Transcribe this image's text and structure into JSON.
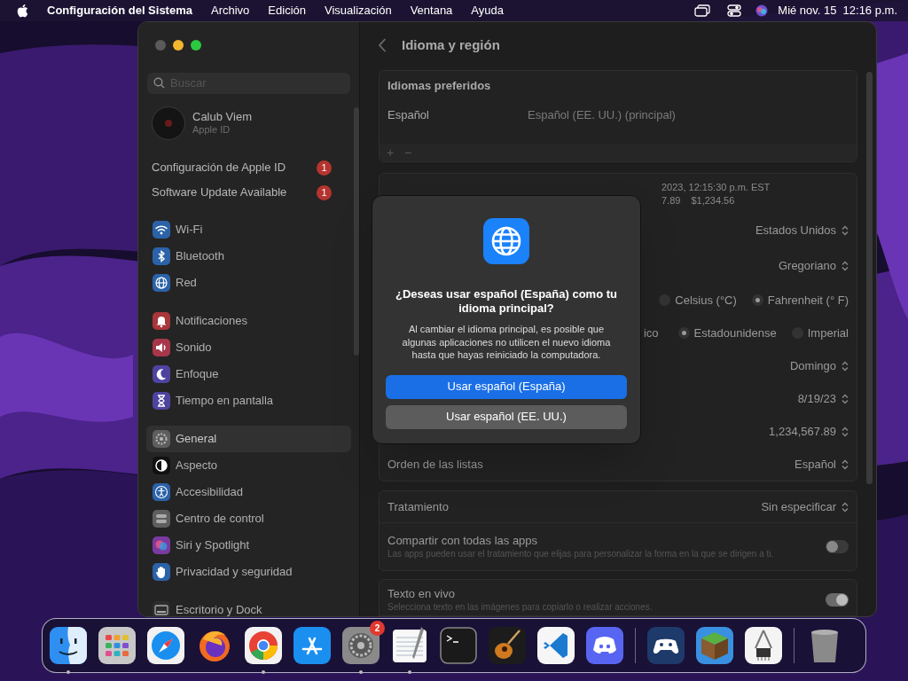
{
  "menu_bar": {
    "app_name": "Configuración del Sistema",
    "menus": [
      "Archivo",
      "Edición",
      "Visualización",
      "Ventana",
      "Ayuda"
    ],
    "date": "Mié nov. 15",
    "time": "12:16 p.m."
  },
  "sidebar": {
    "search": {
      "placeholder": "Buscar"
    },
    "account": {
      "name": "Calub Viem",
      "subtitle": "Apple ID"
    },
    "alerts": [
      {
        "label": "Configuración de Apple ID",
        "badge": "1"
      },
      {
        "label": "Software Update Available",
        "badge": "1"
      }
    ],
    "groups": [
      [
        {
          "label": "Wi-Fi",
          "kind": "wifi",
          "color": "#2b62a8",
          "selected": false
        },
        {
          "label": "Bluetooth",
          "kind": "bluetooth",
          "color": "#2b62a8",
          "selected": false
        },
        {
          "label": "Red",
          "kind": "globe",
          "color": "#2b62a8",
          "selected": false
        }
      ],
      [
        {
          "label": "Notificaciones",
          "kind": "bell",
          "color": "#a8363a",
          "selected": false
        },
        {
          "label": "Sonido",
          "kind": "speaker",
          "color": "#a8364a",
          "selected": false
        },
        {
          "label": "Enfoque",
          "kind": "moon",
          "color": "#4e44a0",
          "selected": false
        },
        {
          "label": "Tiempo en pantalla",
          "kind": "hourglass",
          "color": "#4e44a0",
          "selected": false
        }
      ],
      [
        {
          "label": "General",
          "kind": "gear",
          "color": "#5e5e5e",
          "selected": true
        },
        {
          "label": "Aspecto",
          "kind": "contrast",
          "color": "#111111",
          "selected": false
        },
        {
          "label": "Accesibilidad",
          "kind": "person",
          "color": "#2b62a8",
          "selected": false
        },
        {
          "label": "Centro de control",
          "kind": "switches",
          "color": "#5e5e5e",
          "selected": false
        },
        {
          "label": "Siri y Spotlight",
          "kind": "orb",
          "color": "#7a3aa0",
          "selected": false
        },
        {
          "label": "Privacidad y seguridad",
          "kind": "hand",
          "color": "#2b62a8",
          "selected": false
        }
      ],
      [
        {
          "label": "Escritorio y Dock",
          "kind": "dock",
          "color": "#2e2e2e",
          "selected": false
        }
      ]
    ]
  },
  "content": {
    "title": "Idioma y región",
    "preferred_languages": {
      "heading": "Idiomas preferidos",
      "languages": [
        {
          "name": "Español",
          "detail": "Español (EE. UU.) (principal)"
        }
      ],
      "buttons": [
        "+",
        "−"
      ]
    },
    "format_preview": {
      "line_1": "2023, 12:15:30 p.m. EST",
      "line_2": [
        "7.89",
        "$1,234.56"
      ]
    },
    "format_rows": [
      {
        "kind": "popup",
        "value": "Estados Unidos"
      },
      {
        "kind": "popup",
        "value": "Gregoriano"
      },
      {
        "kind": "radio",
        "options": [
          {
            "label": "Celsius (°C)",
            "selected": false
          },
          {
            "label": "Fahrenheit (° F)",
            "selected": true
          }
        ]
      },
      {
        "kind": "radio",
        "partial_label": "ico",
        "options": [
          {
            "label": "Estadounidense",
            "selected": true
          },
          {
            "label": "Imperial",
            "selected": false
          }
        ]
      },
      {
        "kind": "popup",
        "value": "Domingo"
      },
      {
        "kind": "popup",
        "value": "8/19/23"
      },
      {
        "kind": "popup",
        "value": "1,234,567.89"
      },
      {
        "kind": "popup",
        "label": "Orden de las listas",
        "value": "Español"
      }
    ],
    "form_of_address": [
      {
        "kind": "popup",
        "label": "Tratamiento",
        "value": "Sin especificar"
      },
      {
        "kind": "toggle",
        "label": "Compartir con todas las apps",
        "description": "Las apps pueden usar el tratamiento que elijas para personalizar la forma en la que se dirigen a ti.",
        "on": false
      }
    ],
    "live_text": [
      {
        "kind": "toggle",
        "label": "Texto en vivo",
        "description": "Selecciona texto en las imágenes para copiarlo o realizar acciones.",
        "on": true
      }
    ]
  },
  "dialog": {
    "title": "¿Deseas usar español (España) como tu idioma principal?",
    "message": "Al cambiar el idioma principal, es posible que algunas aplicaciones no utilicen el nuevo idioma hasta que hayas reiniciado la computadora.",
    "buttons": [
      {
        "label": "Usar español (España)",
        "default": true
      },
      {
        "label": "Usar español (EE. UU.)",
        "default": false
      }
    ]
  },
  "dock": [
    {
      "kind": "finder",
      "running": true
    },
    {
      "kind": "launchpad",
      "running": false
    },
    {
      "kind": "safari",
      "running": false
    },
    {
      "kind": "firefox",
      "running": false
    },
    {
      "kind": "chrome",
      "running": true
    },
    {
      "kind": "appstore",
      "running": false
    },
    {
      "kind": "settings",
      "running": true,
      "badge": "2"
    },
    {
      "kind": "textedit",
      "running": true
    },
    {
      "kind": "terminal",
      "running": false
    },
    {
      "kind": "guitar",
      "running": false
    },
    {
      "kind": "code",
      "running": false
    },
    {
      "kind": "discord",
      "running": false
    },
    {
      "kind": "separator"
    },
    {
      "kind": "gamepad",
      "running": false
    },
    {
      "kind": "block",
      "running": false
    },
    {
      "kind": "caliper",
      "running": false
    },
    {
      "kind": "separator"
    },
    {
      "kind": "trash",
      "running": false
    }
  ]
}
